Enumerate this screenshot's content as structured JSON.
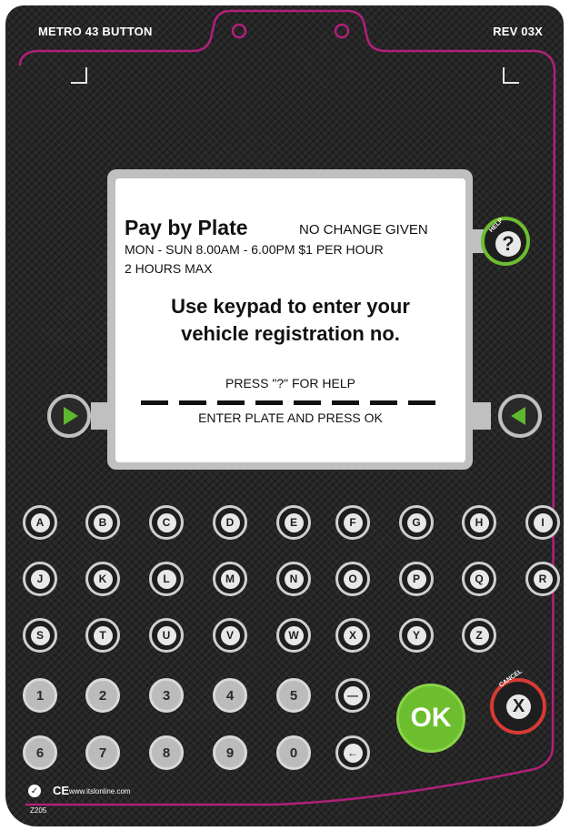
{
  "header": {
    "model": "METRO 43 BUTTON",
    "revision": "REV 03X"
  },
  "screen": {
    "title": "Pay by Plate",
    "notice": "NO CHANGE GIVEN",
    "hours_rate": "MON - SUN  8.00AM - 6.00PM   $1 PER HOUR",
    "max_stay": "2 HOURS MAX",
    "instruction_line1": "Use keypad to enter your",
    "instruction_line2": "vehicle registration no.",
    "help_hint": "PRESS \"?\" FOR HELP",
    "entry_prompt": "ENTER PLATE AND PRESS OK"
  },
  "buttons": {
    "help_label": "HELP",
    "help_symbol": "?",
    "ok_label": "OK",
    "cancel_label": "CANCEL",
    "cancel_symbol": "X",
    "space_symbol": "—",
    "backspace_symbol": "←"
  },
  "keypad": {
    "row1": [
      "A",
      "B",
      "C",
      "D",
      "E",
      "F",
      "G",
      "H",
      "I"
    ],
    "row2": [
      "J",
      "K",
      "L",
      "M",
      "N",
      "O",
      "P",
      "Q",
      "R"
    ],
    "row3": [
      "S",
      "T",
      "U",
      "V",
      "W",
      "X",
      "Y",
      "Z"
    ],
    "row4": [
      "1",
      "2",
      "3",
      "4",
      "5"
    ],
    "row5": [
      "6",
      "7",
      "8",
      "9",
      "0"
    ]
  },
  "footer": {
    "ce": "CE",
    "url": "www.itslonline.com",
    "model_code": "Z205"
  },
  "colors": {
    "body": "#262626",
    "accent_magenta": "#b1207b",
    "ok_green": "#6dbe2e",
    "cancel_red": "#d83a34",
    "arrow_green": "#5cb82e"
  },
  "icons": [
    "left-arrow-icon",
    "right-arrow-icon",
    "help-icon",
    "backspace-icon",
    "space-icon",
    "certification-icon"
  ]
}
